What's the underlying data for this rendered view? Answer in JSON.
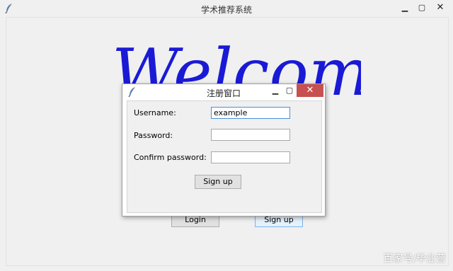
{
  "main_window": {
    "title": "学术推荐系统",
    "welcome_text": "Welcome",
    "welcome_color": "#1a1ad6",
    "login_label": "Login",
    "signup_label": "Sign up",
    "icons": [
      "feather-icon",
      "minimize-icon",
      "maximize-icon",
      "close-icon"
    ]
  },
  "dialog": {
    "title": "注册窗口",
    "fields": [
      {
        "label": "Username:",
        "value": "example"
      },
      {
        "label": "Password:",
        "value": ""
      },
      {
        "label": "Confirm password:",
        "value": ""
      }
    ],
    "signup_label": "Sign up",
    "close_symbol": "✕",
    "close_color": "#c75050"
  },
  "watermark": "百家号/毕业营"
}
